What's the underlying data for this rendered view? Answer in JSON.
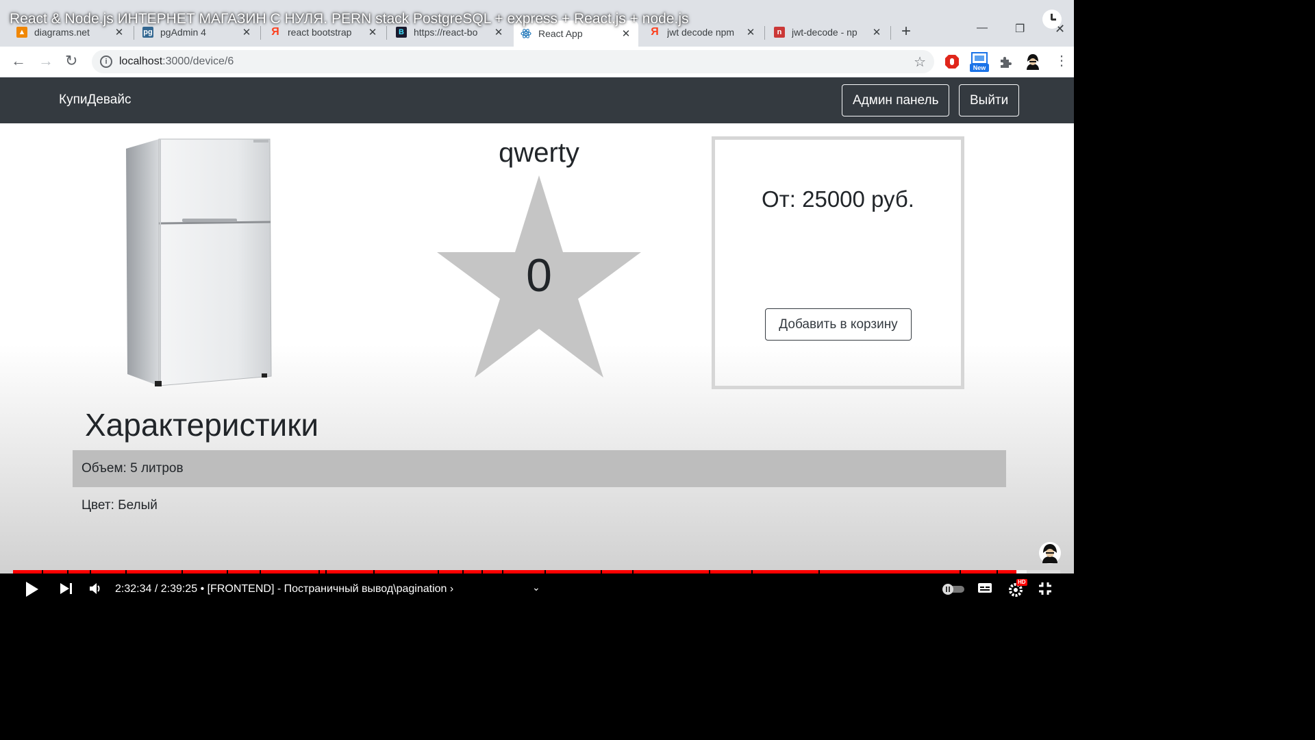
{
  "video": {
    "title": "React & Node.js ИНТЕРНЕТ МАГАЗИН С НУЛЯ. PERN stack PostgreSQL + express + React.js + node.js",
    "time": "2:32:34 / 2:39:25",
    "chapter": "• [FRONTEND] - Постраничный вывод\\pagination",
    "chapter_arrow": "›",
    "progress_fraction": 0.958,
    "buffer_fraction": 0.968,
    "hd_badge": "HD"
  },
  "browser": {
    "tabs": [
      {
        "label": "diagrams.net",
        "icon": "drawio-icon",
        "color": "#f08705"
      },
      {
        "label": "pgAdmin 4",
        "icon": "pgadmin-icon",
        "color": "#336791"
      },
      {
        "label": "react bootstrap",
        "icon": "yandex-icon",
        "color": "#fc3f1d"
      },
      {
        "label": "https://react-bo",
        "icon": "react-bootstrap-icon",
        "color": "#41e0fd"
      },
      {
        "label": "React App",
        "icon": "react-icon",
        "color": "#61dafb"
      },
      {
        "label": "jwt decode npm",
        "icon": "yandex-icon",
        "color": "#fc3f1d"
      },
      {
        "label": "jwt-decode - np",
        "icon": "npm-icon",
        "color": "#cb3837"
      }
    ],
    "close_glyph": "✕",
    "new_tab_glyph": "+",
    "url_host": "localhost",
    "url_path": ":3000/device/6",
    "new_badge": "New"
  },
  "app": {
    "brand": "КупиДевайс",
    "admin_button": "Админ панель",
    "logout_button": "Выйти"
  },
  "device": {
    "name": "qwerty",
    "rating": "0",
    "price": "От: 25000 руб.",
    "add_to_cart": "Добавить в корзину",
    "specs_title": "Характеристики",
    "specs": [
      "Объем: 5 литров",
      "Цвет: Белый"
    ]
  }
}
